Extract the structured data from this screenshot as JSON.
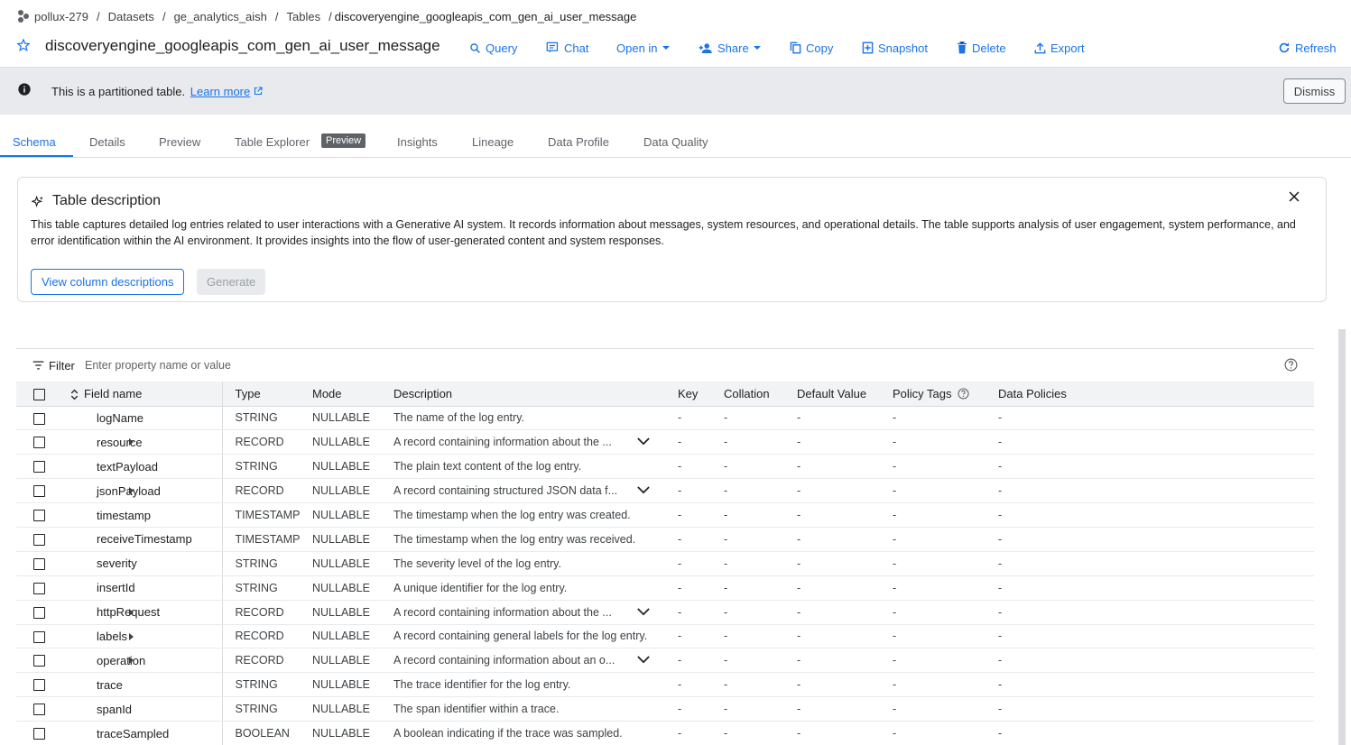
{
  "breadcrumb": {
    "project": "pollux-279",
    "datasets": "Datasets",
    "dataset": "ge_analytics_aish",
    "tables": "Tables",
    "table": "discoveryengine_googleapis_com_gen_ai_user_message"
  },
  "header": {
    "title": "discoveryengine_googleapis_com_gen_ai_user_message",
    "actions": {
      "query": "Query",
      "chat": "Chat",
      "open_in": "Open in",
      "share": "Share",
      "copy": "Copy",
      "snapshot": "Snapshot",
      "delete": "Delete",
      "export": "Export",
      "refresh": "Refresh"
    }
  },
  "banner": {
    "message": "This is a partitioned table.",
    "link": "Learn more",
    "dismiss": "Dismiss"
  },
  "tabs": {
    "schema": "Schema",
    "details": "Details",
    "preview": "Preview",
    "table_explorer": "Table Explorer",
    "table_explorer_badge": "Preview",
    "insights": "Insights",
    "lineage": "Lineage",
    "data_profile": "Data Profile",
    "data_quality": "Data Quality"
  },
  "description_card": {
    "title": "Table description",
    "text": "This table captures detailed log entries related to user interactions with a Generative AI system. It records information about messages, system resources, and operational details. The table supports analysis of user engagement, system performance, and error identification within the AI environment. It provides insights into the flow of user-generated content and system responses.",
    "view_button": "View column descriptions",
    "generate_button": "Generate"
  },
  "filter": {
    "label": "Filter",
    "placeholder": "Enter property name or value"
  },
  "columns": {
    "field_name": "Field name",
    "type": "Type",
    "mode": "Mode",
    "description": "Description",
    "key": "Key",
    "collation": "Collation",
    "default_value": "Default Value",
    "policy_tags": "Policy Tags",
    "data_policies": "Data Policies"
  },
  "rows": [
    {
      "name": "logName",
      "type": "STRING",
      "mode": "NULLABLE",
      "description": "The name of the log entry.",
      "key": "-",
      "collation": "-",
      "default": "-",
      "policy": "-",
      "datapol": "-"
    },
    {
      "name": "resource",
      "type": "RECORD",
      "mode": "NULLABLE",
      "description": "A record containing information about the ...",
      "key": "-",
      "collation": "-",
      "default": "-",
      "policy": "-",
      "datapol": "-"
    },
    {
      "name": "textPayload",
      "type": "STRING",
      "mode": "NULLABLE",
      "description": "The plain text content of the log entry.",
      "key": "-",
      "collation": "-",
      "default": "-",
      "policy": "-",
      "datapol": "-"
    },
    {
      "name": "jsonPayload",
      "type": "RECORD",
      "mode": "NULLABLE",
      "description": "A record containing structured JSON data f...",
      "key": "-",
      "collation": "-",
      "default": "-",
      "policy": "-",
      "datapol": "-"
    },
    {
      "name": "timestamp",
      "type": "TIMESTAMP",
      "mode": "NULLABLE",
      "description": "The timestamp when the log entry was created.",
      "key": "-",
      "collation": "-",
      "default": "-",
      "policy": "-",
      "datapol": "-"
    },
    {
      "name": "receiveTimestamp",
      "type": "TIMESTAMP",
      "mode": "NULLABLE",
      "description": "The timestamp when the log entry was received.",
      "key": "-",
      "collation": "-",
      "default": "-",
      "policy": "-",
      "datapol": "-"
    },
    {
      "name": "severity",
      "type": "STRING",
      "mode": "NULLABLE",
      "description": "The severity level of the log entry.",
      "key": "-",
      "collation": "-",
      "default": "-",
      "policy": "-",
      "datapol": "-"
    },
    {
      "name": "insertId",
      "type": "STRING",
      "mode": "NULLABLE",
      "description": "A unique identifier for the log entry.",
      "key": "-",
      "collation": "-",
      "default": "-",
      "policy": "-",
      "datapol": "-"
    },
    {
      "name": "httpRequest",
      "type": "RECORD",
      "mode": "NULLABLE",
      "description": "A record containing information about the ...",
      "key": "-",
      "collation": "-",
      "default": "-",
      "policy": "-",
      "datapol": "-"
    },
    {
      "name": "labels",
      "type": "RECORD",
      "mode": "NULLABLE",
      "description": "A record containing general labels for the log entry.",
      "key": "-",
      "collation": "-",
      "default": "-",
      "policy": "-",
      "datapol": "-"
    },
    {
      "name": "operation",
      "type": "RECORD",
      "mode": "NULLABLE",
      "description": "A record containing information about an o...",
      "key": "-",
      "collation": "-",
      "default": "-",
      "policy": "-",
      "datapol": "-"
    },
    {
      "name": "trace",
      "type": "STRING",
      "mode": "NULLABLE",
      "description": "The trace identifier for the log entry.",
      "key": "-",
      "collation": "-",
      "default": "-",
      "policy": "-",
      "datapol": "-"
    },
    {
      "name": "spanId",
      "type": "STRING",
      "mode": "NULLABLE",
      "description": "The span identifier within a trace.",
      "key": "-",
      "collation": "-",
      "default": "-",
      "policy": "-",
      "datapol": "-"
    },
    {
      "name": "traceSampled",
      "type": "BOOLEAN",
      "mode": "NULLABLE",
      "description": "A boolean indicating if the trace was sampled.",
      "key": "-",
      "collation": "-",
      "default": "-",
      "policy": "-",
      "datapol": "-"
    }
  ]
}
